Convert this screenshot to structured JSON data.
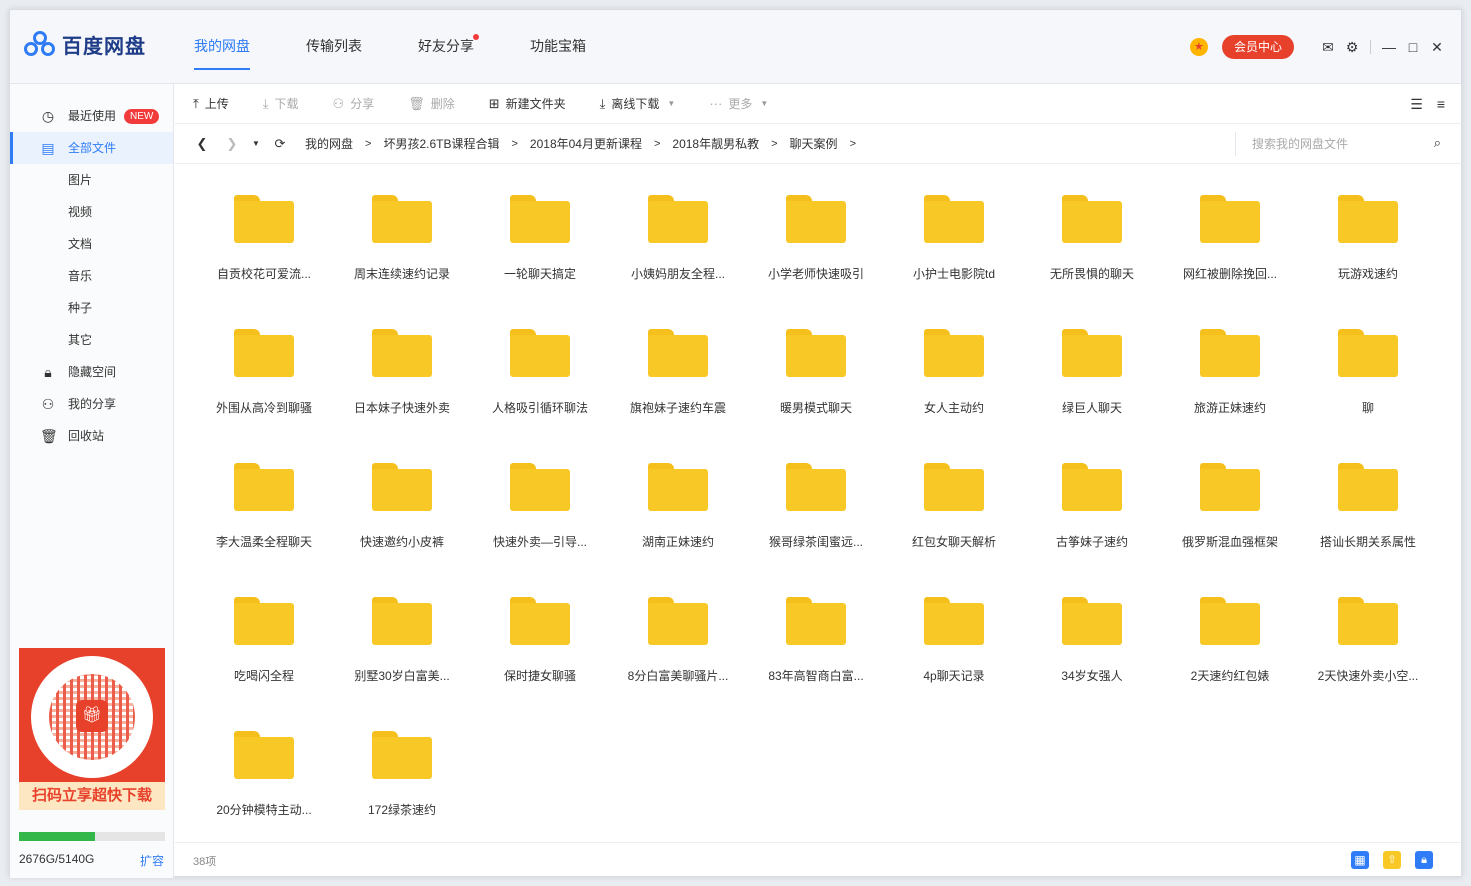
{
  "app": {
    "logo_text": "百度网盘"
  },
  "nav": [
    {
      "label": "我的网盘",
      "active": true
    },
    {
      "label": "传输列表",
      "active": false
    },
    {
      "label": "好友分享",
      "active": false,
      "dot": true
    },
    {
      "label": "功能宝箱",
      "active": false
    }
  ],
  "header": {
    "vip_label": "会员中心"
  },
  "sidebar": {
    "items": [
      {
        "label": "最近使用",
        "icon": "clock-icon",
        "badge": "NEW"
      },
      {
        "label": "全部文件",
        "icon": "document-icon",
        "active": true
      },
      {
        "label": "图片"
      },
      {
        "label": "视频"
      },
      {
        "label": "文档"
      },
      {
        "label": "音乐"
      },
      {
        "label": "种子"
      },
      {
        "label": "其它"
      },
      {
        "label": "隐藏空间",
        "icon": "lock-icon"
      },
      {
        "label": "我的分享",
        "icon": "share-icon"
      },
      {
        "label": "回收站",
        "icon": "trash-icon"
      }
    ],
    "promo_text": "扫码立享超快下载",
    "storage": {
      "text": "2676G/5140G",
      "used_fraction": 0.52,
      "expand_label": "扩容"
    }
  },
  "toolbar": {
    "upload": "上传",
    "download": "下载",
    "share": "分享",
    "delete": "删除",
    "new_folder": "新建文件夹",
    "offline_download": "离线下载",
    "more": "更多"
  },
  "breadcrumb": [
    "我的网盘",
    "坏男孩2.6TB课程合辑",
    "2018年04月更新课程",
    "2018年靓男私教",
    "聊天案例"
  ],
  "search": {
    "placeholder": "搜索我的网盘文件"
  },
  "files": [
    "自贡校花可爱流...",
    "周末连续速约记录",
    "一轮聊天搞定",
    "小姨妈朋友全程...",
    "小学老师快速吸引",
    "小护士电影院td",
    "无所畏惧的聊天",
    "网红被删除挽回...",
    "玩游戏速约",
    "外围从高冷到聊骚",
    "日本妹子快速外卖",
    "人格吸引循环聊法",
    "旗袍妹子速约车震",
    "暖男模式聊天",
    "女人主动约",
    "绿巨人聊天",
    "旅游正妹速约",
    "聊",
    "李大温柔全程聊天",
    "快速邀约小皮裤",
    "快速外卖—引导...",
    "湖南正妹速约",
    "猴哥绿茶闺蜜远...",
    "红包女聊天解析",
    "古筝妹子速约",
    "俄罗斯混血强框架",
    "搭讪长期关系属性",
    "吃喝闪全程",
    "别墅30岁白富美...",
    "保时捷女聊骚",
    "8分白富美聊骚片...",
    "83年高智商白富...",
    "4p聊天记录",
    "34岁女强人",
    "2天速约红包婊",
    "2天快速外卖小空...",
    "20分钟模特主动...",
    "172绿茶速约"
  ],
  "status": {
    "count": "38项"
  },
  "colors": {
    "accent": "#2f7cf6",
    "folder": "#f8c926",
    "vip": "#e8412b",
    "storage": "#33b64a"
  }
}
